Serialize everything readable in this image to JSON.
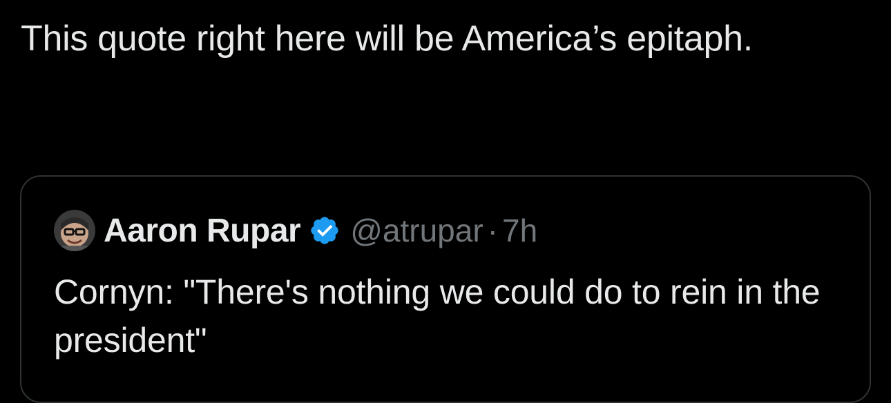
{
  "tweet": {
    "text": "This quote right here will be America’s epitaph."
  },
  "quote": {
    "author_name": "Aaron Rupar",
    "handle": "@atrupar",
    "separator": "·",
    "time": "7h",
    "text": "Cornyn: \"There's nothing we could do to rein in the president\"",
    "avatar_icon": "avatar-photo",
    "verified_icon": "verified-badge-icon"
  },
  "colors": {
    "background": "#000000",
    "text_primary": "#e7e9ea",
    "text_secondary": "#71767b",
    "border": "#2f3336",
    "verified_blue": "#1d9bf0"
  }
}
